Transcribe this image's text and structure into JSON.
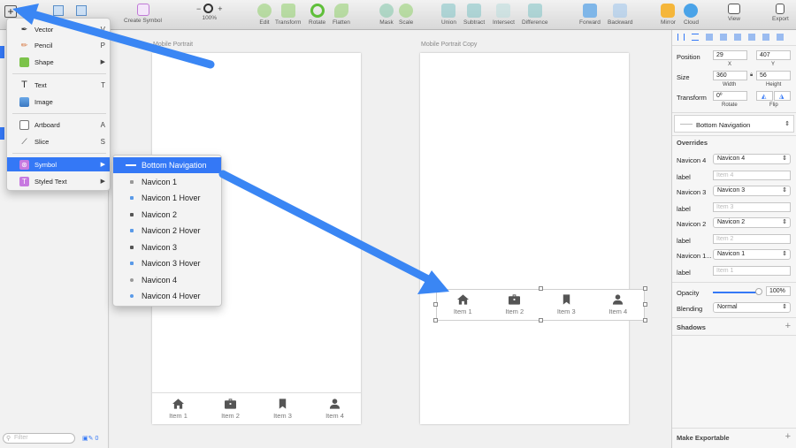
{
  "toolbar": {
    "create_symbol": "Create Symbol",
    "zoom_minus": "−",
    "zoom_plus": "+",
    "zoom_level": "100%",
    "edit": "Edit",
    "transform": "Transform",
    "rotate": "Rotate",
    "flatten": "Flatten",
    "mask": "Mask",
    "scale": "Scale",
    "union": "Union",
    "subtract": "Subtract",
    "intersect": "Intersect",
    "difference": "Difference",
    "forward": "Forward",
    "backward": "Backward",
    "mirror": "Mirror",
    "cloud": "Cloud",
    "view": "View",
    "export": "Export"
  },
  "colors": {
    "accent": "#3478f6",
    "arrow": "#3a86f4",
    "nav_icon": "#555555"
  },
  "sidebar": {
    "filter_placeholder": "Filter",
    "filter_icon": "search-icon",
    "tools_label": "0"
  },
  "menu": {
    "items": [
      {
        "label": "Vector",
        "key": "V",
        "icon": "vector-pen-icon"
      },
      {
        "label": "Pencil",
        "key": "P",
        "icon": "pencil-icon"
      },
      {
        "label": "Shape",
        "key": "▶",
        "icon": "shape-icon"
      },
      {
        "label": "Text",
        "key": "T",
        "icon": "text-icon"
      },
      {
        "label": "Image",
        "key": "",
        "icon": "image-icon"
      },
      {
        "label": "Artboard",
        "key": "A",
        "icon": "artboard-icon"
      },
      {
        "label": "Slice",
        "key": "S",
        "icon": "slice-knife-icon"
      },
      {
        "label": "Symbol",
        "key": "▶",
        "icon": "symbol-icon"
      },
      {
        "label": "Styled Text",
        "key": "▶",
        "icon": "styled-text-icon"
      }
    ],
    "submenu": [
      "Bottom Navigation",
      "Navicon 1",
      "Navicon 1 Hover",
      "Navicon 2",
      "Navicon 2 Hover",
      "Navicon 3",
      "Navicon 3 Hover",
      "Navicon 4",
      "Navicon 4 Hover"
    ]
  },
  "canvas": {
    "artboard1_label": "Mobile Portrait",
    "artboard2_label": "Mobile Portrait Copy",
    "nav_items": [
      {
        "label": "Item 1",
        "icon": "home-icon"
      },
      {
        "label": "Item 2",
        "icon": "briefcase-icon"
      },
      {
        "label": "Item 3",
        "icon": "bookmark-icon"
      },
      {
        "label": "Item 4",
        "icon": "person-icon"
      }
    ]
  },
  "inspector": {
    "position_label": "Position",
    "x": "29",
    "y": "407",
    "x_label": "X",
    "y_label": "Y",
    "size_label": "Size",
    "width": "360",
    "height": "56",
    "width_label": "Width",
    "height_label": "Height",
    "transform_label": "Transform",
    "rotate": "0º",
    "rotate_label": "Rotate",
    "flip_label": "Flip",
    "symbol_name": "Bottom Navigation",
    "overrides_label": "Overrides",
    "overrides": [
      {
        "label": "Navicon 4",
        "value": "Navicon 4",
        "text_label": "label",
        "placeholder": "Item 4"
      },
      {
        "label": "Navicon 3",
        "value": "Navicon 3",
        "text_label": "label",
        "placeholder": "Item 3"
      },
      {
        "label": "Navicon 2",
        "value": "Navicon 2",
        "text_label": "label",
        "placeholder": "Item 2"
      },
      {
        "label": "Navicon 1...",
        "value": "Navicon 1",
        "text_label": "label",
        "placeholder": "Item 1"
      }
    ],
    "opacity_label": "Opacity",
    "opacity": "100%",
    "opacity_level": 1.0,
    "blending_label": "Blending",
    "blending": "Normal",
    "shadows_label": "Shadows",
    "shadows_add": "+",
    "exportable_label": "Make Exportable",
    "exportable_add": "+"
  }
}
